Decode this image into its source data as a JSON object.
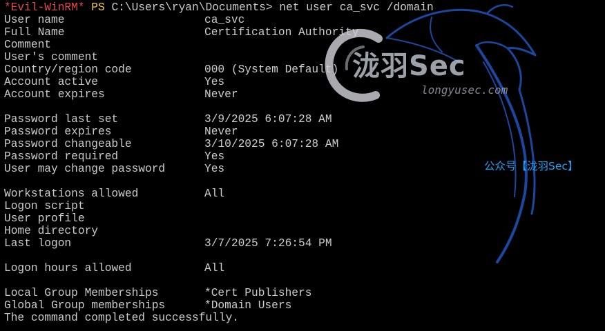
{
  "prompt": {
    "shell_name": "*Evil-WinRM*",
    "ps": "PS",
    "command": "C:\\Users\\ryan\\Documents> net user ca_svc /domain"
  },
  "output": {
    "rows": [
      {
        "label": "User name",
        "value": "ca_svc"
      },
      {
        "label": "Full Name",
        "value": "Certification Authority"
      },
      {
        "label": "Comment",
        "value": ""
      },
      {
        "label": "User's comment",
        "value": ""
      },
      {
        "label": "Country/region code",
        "value": "000 (System Default)"
      },
      {
        "label": "Account active",
        "value": "Yes"
      },
      {
        "label": "Account expires",
        "value": "Never"
      },
      {
        "label": "",
        "value": ""
      },
      {
        "label": "Password last set",
        "value": "3/9/2025 6:07:28 AM"
      },
      {
        "label": "Password expires",
        "value": "Never"
      },
      {
        "label": "Password changeable",
        "value": "3/10/2025 6:07:28 AM"
      },
      {
        "label": "Password required",
        "value": "Yes"
      },
      {
        "label": "User may change password",
        "value": "Yes"
      },
      {
        "label": "",
        "value": ""
      },
      {
        "label": "Workstations allowed",
        "value": "All"
      },
      {
        "label": "Logon script",
        "value": ""
      },
      {
        "label": "User profile",
        "value": ""
      },
      {
        "label": "Home directory",
        "value": ""
      },
      {
        "label": "Last logon",
        "value": "3/7/2025 7:26:54 PM"
      },
      {
        "label": "",
        "value": ""
      },
      {
        "label": "Logon hours allowed",
        "value": "All"
      },
      {
        "label": "",
        "value": ""
      },
      {
        "label": "Local Group Memberships",
        "value": "*Cert Publishers"
      },
      {
        "label": "Global Group memberships",
        "value": "*Domain Users"
      }
    ],
    "completion": "The command completed successfully."
  },
  "watermark": {
    "brand": "泷羽Sec",
    "url": "longyusec.com",
    "wechat": "公众号【泷羽Sec】"
  },
  "colors": {
    "background": "#000000",
    "text": "#cccccc",
    "prompt_shell": "#e5484d",
    "prompt_ps": "#f2d04a",
    "dragon_outline": "#1f4fb0",
    "wechat_text": "#21a0f0"
  }
}
